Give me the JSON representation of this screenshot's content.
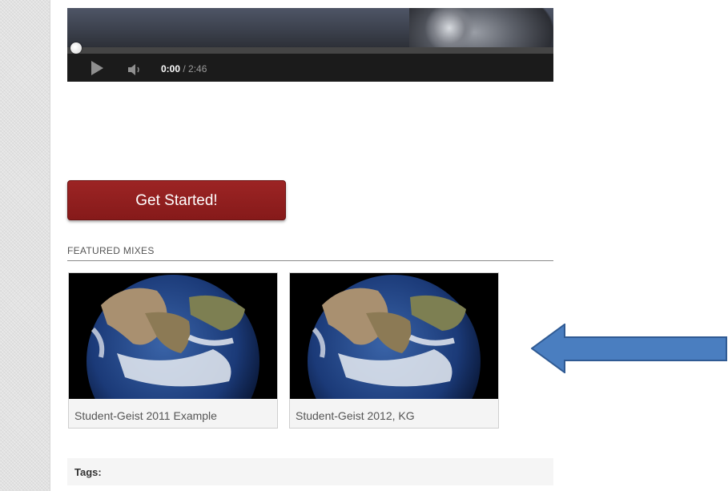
{
  "video": {
    "time_current": "0:00",
    "time_total": "/ 2:46",
    "progress_fraction": 0.0
  },
  "cta": {
    "label": "Get Started!"
  },
  "featured": {
    "title": "FEATURED MIXES",
    "mixes": [
      {
        "label": "Student-Geist 2011 Example",
        "thumb_icon": "earth-globe-icon"
      },
      {
        "label": "Student-Geist 2012, KG",
        "thumb_icon": "earth-globe-icon"
      }
    ]
  },
  "tags": {
    "label": "Tags:"
  },
  "colors": {
    "cta_red": "#8f1e1e",
    "arrow_blue": "#4a7ec0",
    "arrow_outline": "#2f5a93"
  },
  "annotation": {
    "icon": "left-arrow-icon"
  }
}
